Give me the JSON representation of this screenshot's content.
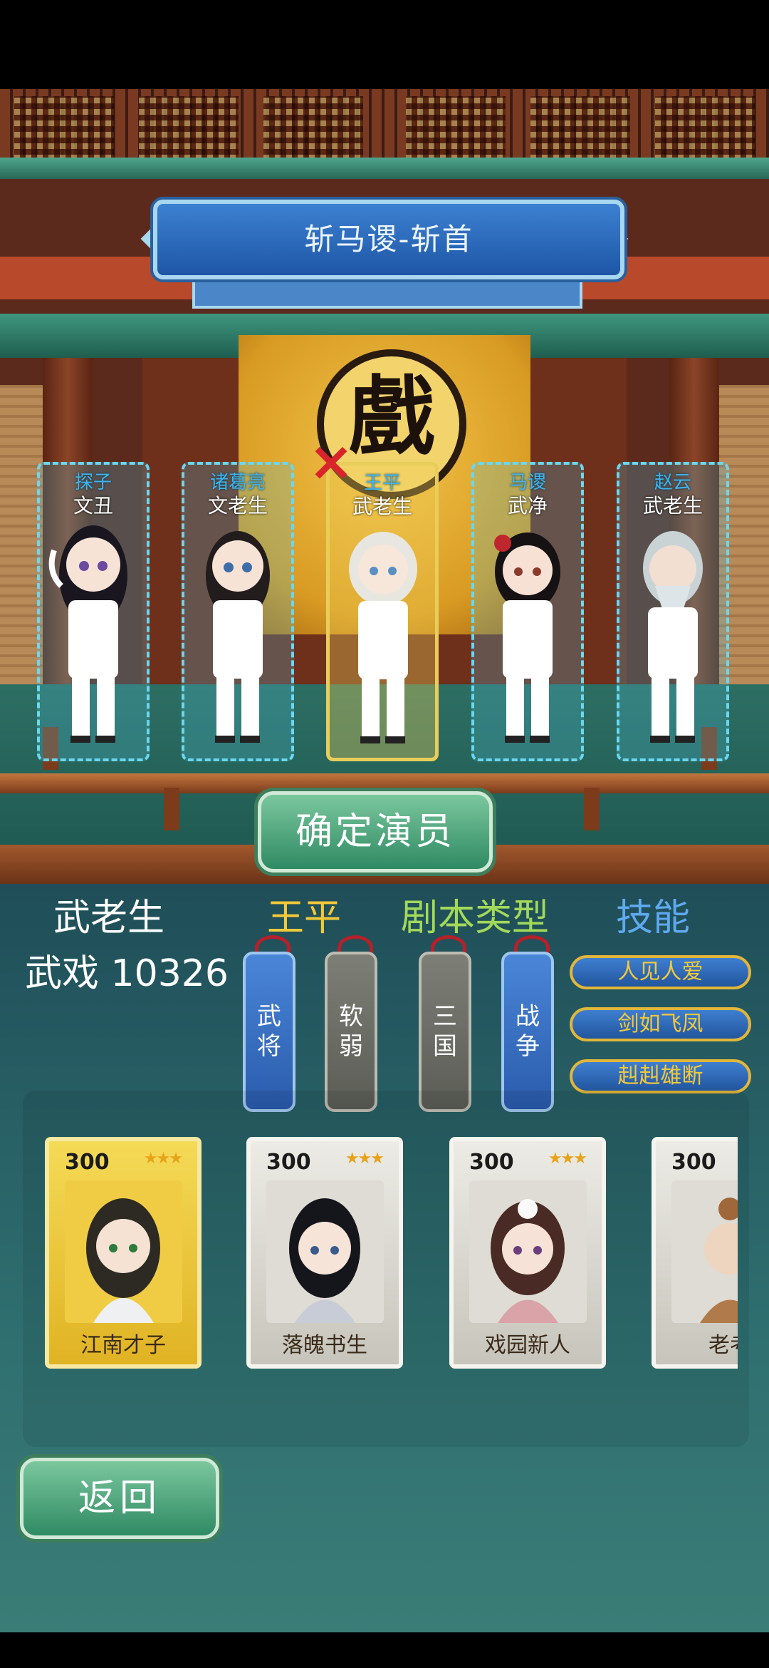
{
  "stage": {
    "title": "斩马谡-斩首",
    "sign_char": "戲"
  },
  "slots": [
    {
      "name": "探子",
      "role": "文丑",
      "selected": false
    },
    {
      "name": "诸葛亮",
      "role": "文老生",
      "selected": false
    },
    {
      "name": "王平",
      "role": "武老生",
      "selected": true
    },
    {
      "name": "马谡",
      "role": "武净",
      "selected": false
    },
    {
      "name": "赵云",
      "role": "武老生",
      "selected": false
    }
  ],
  "remove_icon": "×",
  "confirm_label": "确定演员",
  "info": {
    "role_label": "武老生",
    "role_value": "武戏 10326",
    "actor_name": "王平",
    "script_type_label": "剧本类型",
    "skills_label": "技能",
    "actor_tags": [
      "武将",
      "软弱"
    ],
    "script_tags": [
      "三国",
      "战争"
    ],
    "skills": [
      "人见人爱",
      "剑如飞凤",
      "赳赳雄断"
    ]
  },
  "cards": [
    {
      "cost": "300",
      "stars": "★★★",
      "name": "江南才子",
      "style": "gold"
    },
    {
      "cost": "300",
      "stars": "★★★",
      "name": "落魄书生",
      "style": "silver"
    },
    {
      "cost": "300",
      "stars": "★★★",
      "name": "戏园新人",
      "style": "silver"
    },
    {
      "cost": "300",
      "stars": "",
      "name": "老考",
      "style": "silver"
    }
  ],
  "back_label": "返回",
  "colors": {
    "slot_border": "#6ad7f0",
    "selected_border": "#e8cd5a",
    "actor_name_color": "#f3c93a",
    "script_type_color": "#a3d95a",
    "skills_color": "#5fa9f0",
    "tag_blue": "#2a5bab",
    "tag_grey": "#5a5c55"
  }
}
